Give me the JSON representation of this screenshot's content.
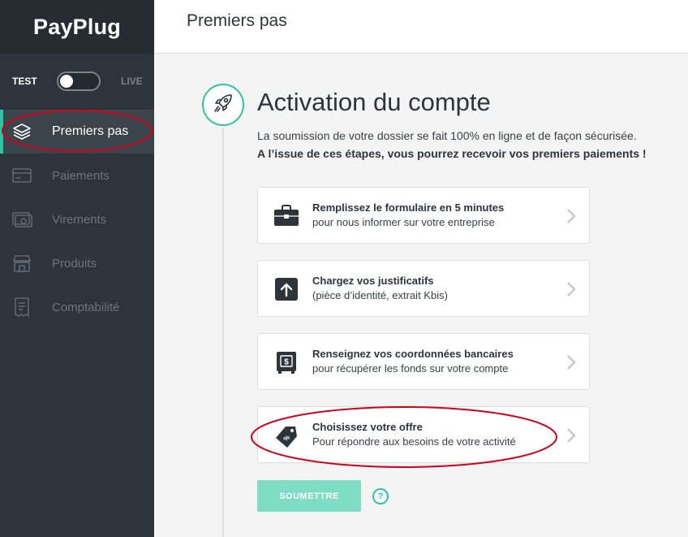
{
  "app": {
    "logo": "PayPlug"
  },
  "mode": {
    "test_label": "TEST",
    "live_label": "LIVE",
    "is_live": false
  },
  "sidebar": {
    "items": [
      {
        "label": "Premiers pas",
        "icon": "layers-icon",
        "active": true
      },
      {
        "label": "Paiements",
        "icon": "card-icon",
        "active": false
      },
      {
        "label": "Virements",
        "icon": "transfer-icon",
        "active": false
      },
      {
        "label": "Produits",
        "icon": "store-icon",
        "active": false
      },
      {
        "label": "Comptabilité",
        "icon": "receipt-icon",
        "active": false
      }
    ]
  },
  "header": {
    "title": "Premiers pas"
  },
  "main": {
    "title": "Activation du compte",
    "intro": "La soumission de votre dossier se fait 100% en ligne et de façon sécurisée.",
    "intro_bold": "A l’issue de ces étapes, vous pourrez recevoir vos premiers paiements !",
    "steps": [
      {
        "title": "Remplissez le formulaire en 5 minutes",
        "subtitle": "pour nous informer sur votre entreprise",
        "icon": "briefcase-icon"
      },
      {
        "title": "Chargez vos justificatifs",
        "subtitle": "(pièce d’identité, extrait Kbis)",
        "icon": "upload-icon"
      },
      {
        "title": "Renseignez vos coordonnées bancaires",
        "subtitle": "pour récupérer les fonds sur votre compte",
        "icon": "safe-icon"
      },
      {
        "title": "Choisissez votre offre",
        "subtitle": "Pour répondre aux besoins de votre activité",
        "icon": "price-tag-icon"
      }
    ],
    "submit_label": "SOUMETTRE",
    "help_label": "?"
  },
  "colors": {
    "accent": "#2ec4a0",
    "sidebar_bg": "#2d343b",
    "annotation": "#d0021b"
  }
}
